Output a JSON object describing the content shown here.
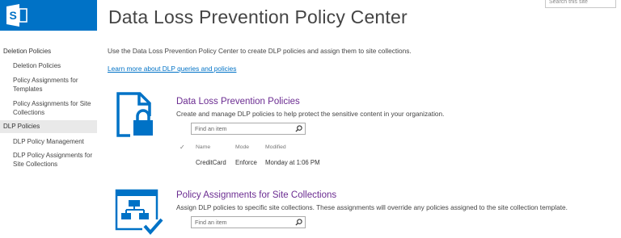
{
  "app": {
    "title": "Data Loss Prevention Policy Center"
  },
  "colors": {
    "brand": "#0072c6",
    "section_title": "#6b2c91",
    "nav_selected_bg": "#e9e9e9"
  },
  "search": {
    "placeholder": "Search this site"
  },
  "sidebar": {
    "groups": [
      {
        "label": "Deletion Policies",
        "items": [
          {
            "label": "Deletion Policies"
          },
          {
            "label": "Policy Assignments for Templates"
          },
          {
            "label": "Policy Assignments for Site Collections"
          }
        ]
      },
      {
        "label": "DLP Policies",
        "selected": true,
        "items": [
          {
            "label": "DLP Policy Management"
          },
          {
            "label": "DLP Policy Assignments for Site Collections"
          }
        ]
      }
    ]
  },
  "main": {
    "intro": "Use the Data Loss Prevention Policy Center to create DLP policies and assign them to site collections.",
    "learn_more": "Learn more about DLP queries and policies",
    "sections": [
      {
        "title": "Data Loss Prevention Policies",
        "icon": "document-lock-icon",
        "description": "Create and manage DLP policies to help protect the sensitive content in your organization.",
        "find_placeholder": "Find an item",
        "table": {
          "select_glyph": "✓",
          "columns": [
            "Name",
            "Mode",
            "Modified"
          ],
          "rows": [
            {
              "name": "CreditCard",
              "mode": "Enforce",
              "modified": "Monday at 1:06 PM"
            }
          ]
        }
      },
      {
        "title": "Policy Assignments for Site Collections",
        "icon": "site-hierarchy-check-icon",
        "description": "Assign DLP policies to specific site collections. These assignments will override any policies assigned to the site collection template.",
        "find_placeholder": "Find an item"
      }
    ]
  }
}
